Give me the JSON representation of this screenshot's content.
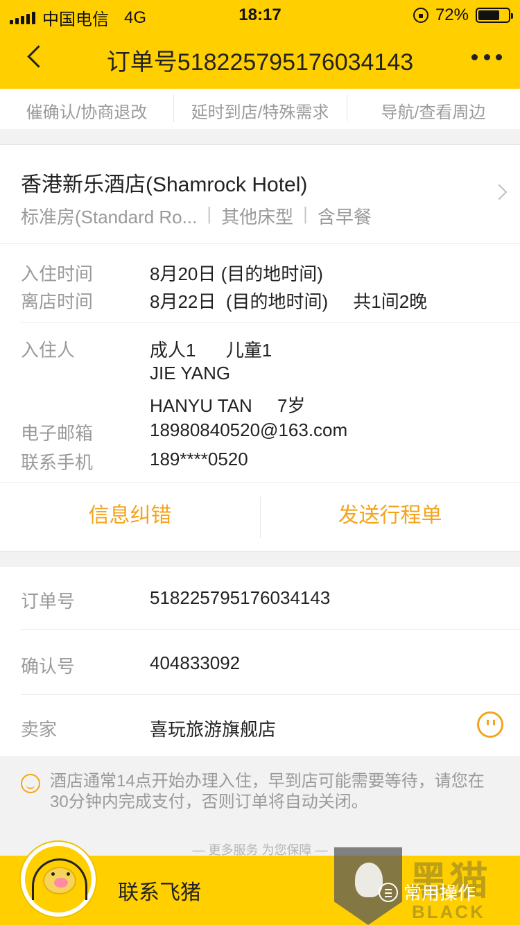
{
  "status_bar": {
    "carrier": "中国电信",
    "network": "4G",
    "time": "18:17",
    "battery_text": "72%",
    "battery_level": 0.72
  },
  "nav": {
    "title": "订单号518225795176034143"
  },
  "quick_actions": [
    {
      "label": "催确认/协商退改"
    },
    {
      "label": "延时到店/特殊需求"
    },
    {
      "label": "导航/查看周边"
    }
  ],
  "hotel": {
    "name": "香港新乐酒店(Shamrock Hotel)",
    "room_type": "标准房(Standard Ro...",
    "sep1": "|",
    "bed": "其他床型",
    "sep2": "|",
    "breakfast": "含早餐"
  },
  "stay": {
    "checkin_label": "入住时间",
    "checkin_value": "8月20日  (目的地时间)",
    "checkout_label": "离店时间",
    "checkout_value": "8月22日  (目的地时间)     共1间2晚"
  },
  "guests": {
    "label": "入住人",
    "line1": "成人1      儿童1",
    "line2": "JIE YANG",
    "line3": "HANYU TAN     7岁",
    "email_label": "电子邮箱",
    "email_value": "18980840520@163.com",
    "phone_label": "联系手机",
    "phone_value": "189****0520"
  },
  "actions": {
    "correct": "信息纠错",
    "send_itinerary": "发送行程单"
  },
  "order": {
    "order_no_label": "订单号",
    "order_no_value": "518225795176034143",
    "confirm_label": "确认号",
    "confirm_value": "404833092",
    "seller_label": "卖家",
    "seller_value": "喜玩旅游旗舰店"
  },
  "notice": {
    "text": "酒店通常14点开始办理入住，早到店可能需要等待，请您在30分钟内完成支付，否则订单将自动关闭。"
  },
  "footer": {
    "more_service": "— 更多服务 为您保障 —",
    "contact": "联系飞猪",
    "ops": "常用操作"
  },
  "watermark": {
    "big": "黑猫",
    "small": "BLACK CAT"
  },
  "colors": {
    "brand_yellow": "#ffcf00",
    "action_orange": "#f4a41c"
  }
}
